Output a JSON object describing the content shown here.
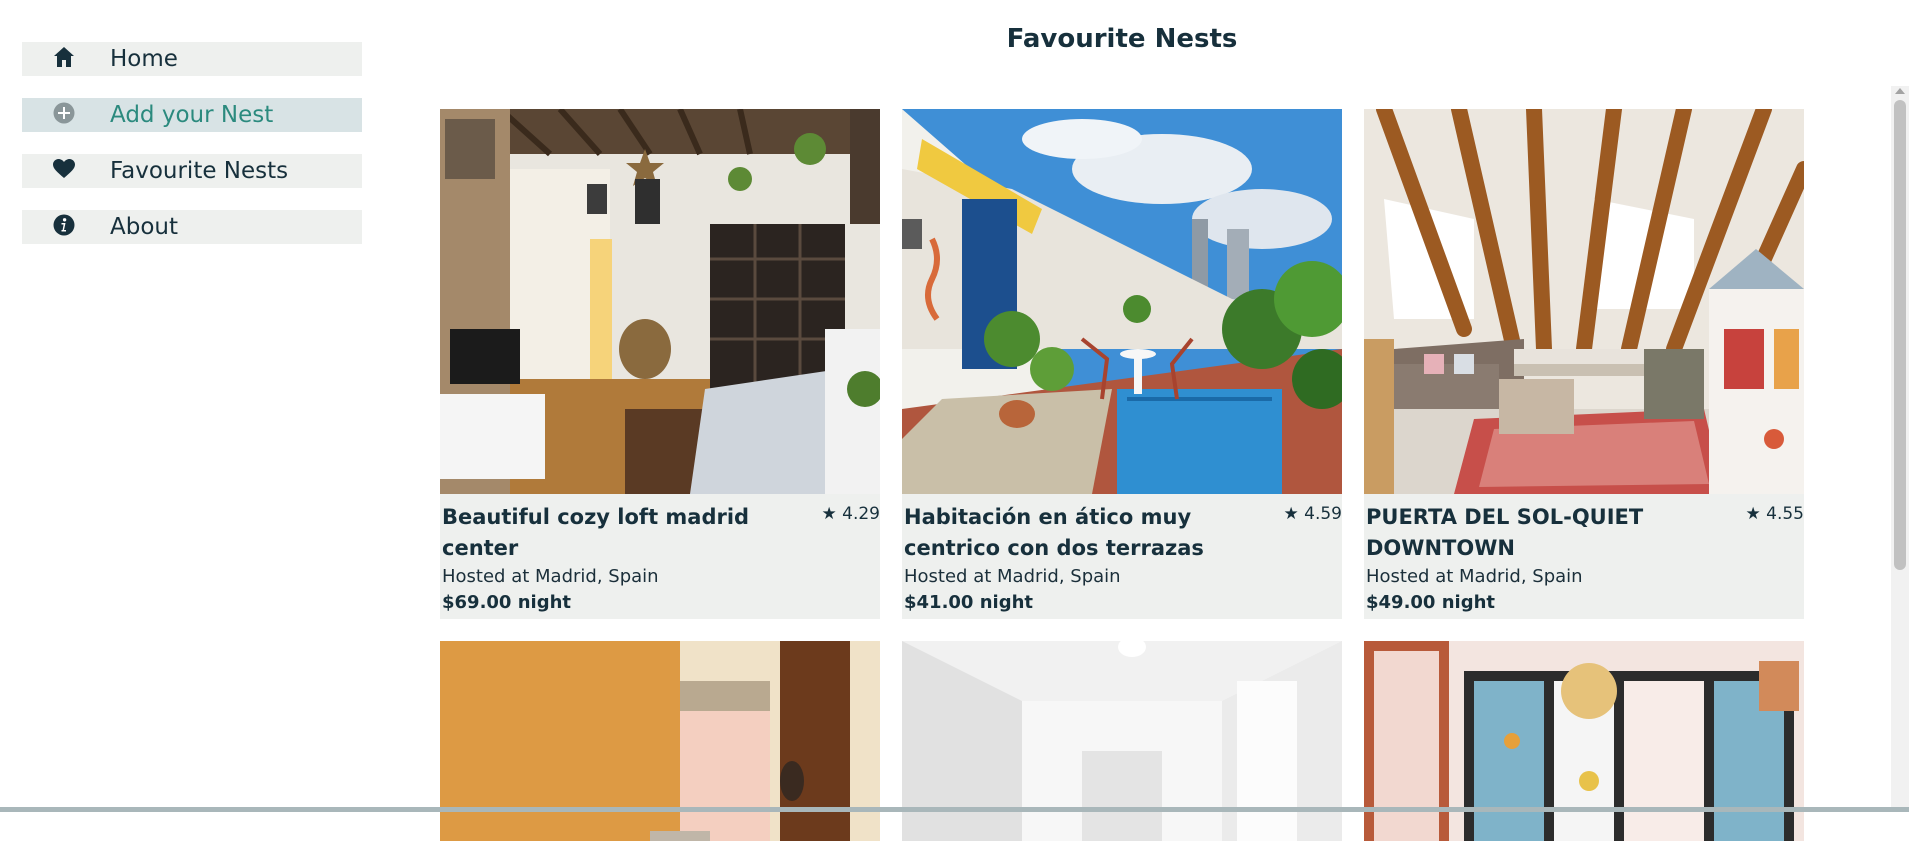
{
  "sidebar": {
    "items": [
      {
        "label": "Home",
        "icon": "home-icon",
        "active": false
      },
      {
        "label": "Add your Nest",
        "icon": "plus-circle-icon",
        "active": true
      },
      {
        "label": "Favourite Nests",
        "icon": "heart-icon",
        "active": false
      },
      {
        "label": "About",
        "icon": "info-icon",
        "active": false
      }
    ]
  },
  "main": {
    "title": "Favourite Nests",
    "listings": [
      {
        "title": "Beautiful cozy loft madrid center",
        "rating": "★ 4.29",
        "location": "Hosted at Madrid, Spain",
        "price": "$69.00 night"
      },
      {
        "title": "Habitación en ático muy centrico con dos terrazas",
        "rating": "★ 4.59",
        "location": "Hosted at Madrid, Spain",
        "price": "$41.00 night"
      },
      {
        "title": "PUERTA DEL SOL-QUIET DOWNTOWN",
        "rating": "★ 4.55",
        "location": "Hosted at Madrid, Spain",
        "price": "$49.00 night"
      }
    ]
  },
  "colors": {
    "nav_background": "#eef0ee",
    "nav_active_background": "#d8e3e5",
    "accent": "#2b8a7e",
    "text_dark": "#17303c"
  }
}
